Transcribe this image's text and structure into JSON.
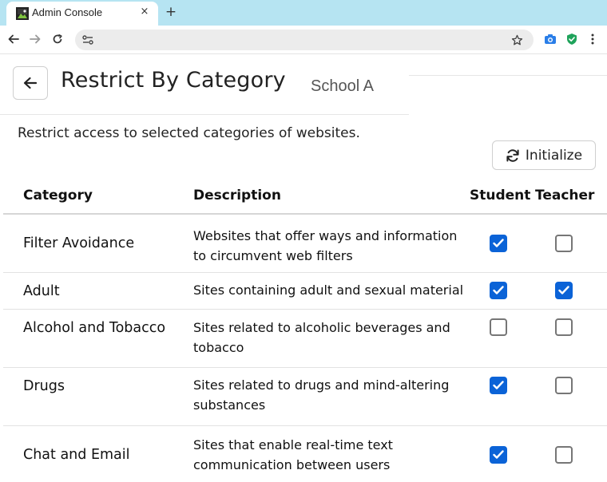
{
  "browser": {
    "tab_title": "Admin Console",
    "tab_favicon": "admin-console-favicon-icon",
    "close_glyph": "×",
    "new_tab_glyph": "+"
  },
  "header": {
    "title": "Restrict By Category",
    "school": "School A"
  },
  "description": "Restrict access to selected categories of websites.",
  "initialize_label": "Initialize",
  "table": {
    "columns": {
      "category": "Category",
      "description": "Description",
      "student": "Student",
      "teacher": "Teacher"
    },
    "rows": [
      {
        "category": "Filter Avoidance",
        "description": "Websites that offer ways and information to circumvent web filters",
        "student": true,
        "teacher": false
      },
      {
        "category": "Adult",
        "description": "Sites containing adult and sexual material",
        "student": true,
        "teacher": true
      },
      {
        "category": "Alcohol and Tobacco",
        "description": "Sites related to alcoholic beverages and tobacco",
        "student": false,
        "teacher": false
      },
      {
        "category": "Drugs",
        "description": "Sites related to drugs and mind-altering substances",
        "student": true,
        "teacher": false
      },
      {
        "category": "Chat and Email",
        "description": "Sites that enable real-time text communication between users",
        "student": true,
        "teacher": false
      }
    ]
  },
  "colors": {
    "checkbox_checked": "#0b63d7",
    "tabstrip": "#b6e4f2"
  }
}
